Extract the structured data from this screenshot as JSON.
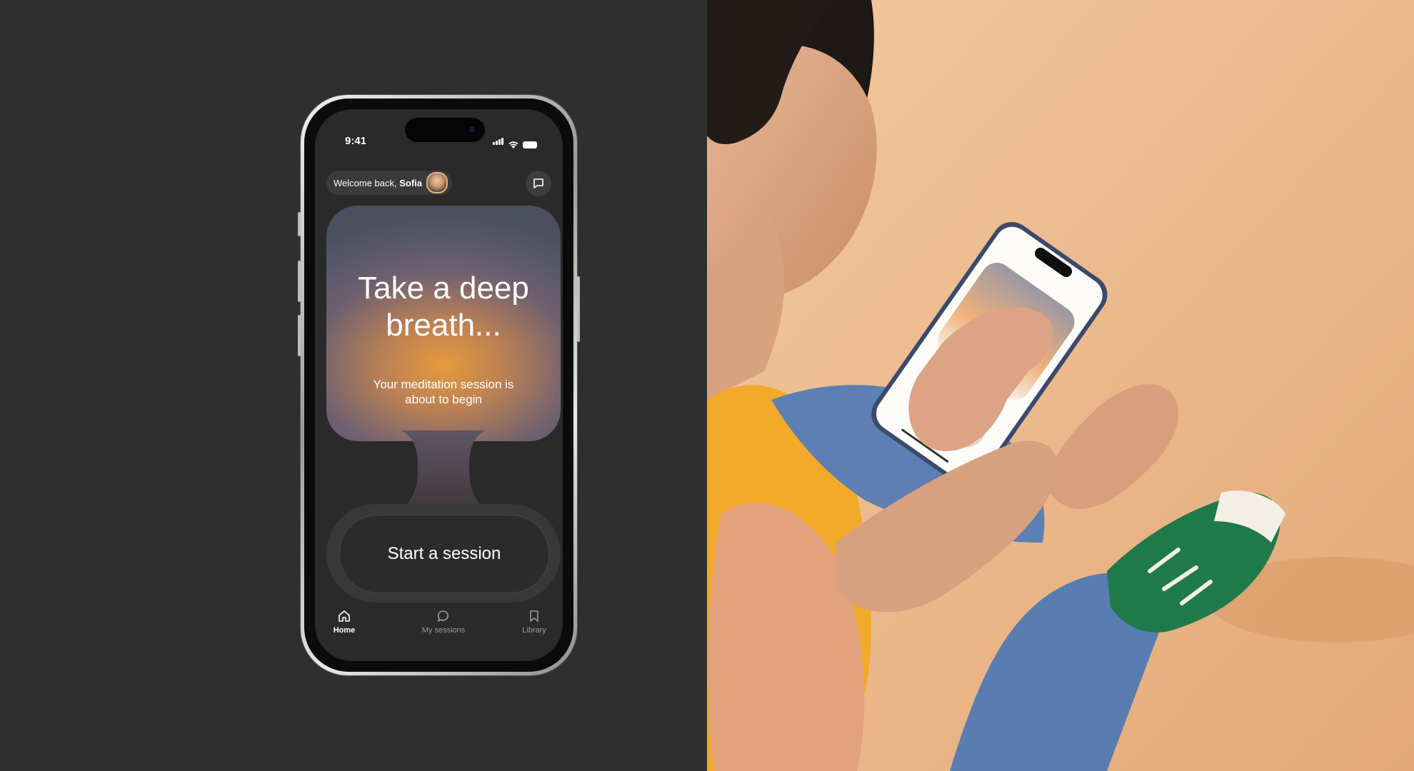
{
  "status_bar": {
    "time": "9:41"
  },
  "header": {
    "welcome_prefix": "Welcome back, ",
    "user_name": "Sofia"
  },
  "hero": {
    "title_line1": "Take a deep",
    "title_line2": "breath...",
    "subtitle_line1": "Your meditation session is",
    "subtitle_line2": "about to begin"
  },
  "session_button": {
    "label": "Start a session"
  },
  "tabs": [
    {
      "label": "Home",
      "icon": "home-icon",
      "active": true
    },
    {
      "label": "My sessions",
      "icon": "chat-bubble-icon",
      "active": false
    },
    {
      "label": "Library",
      "icon": "bookmark-icon",
      "active": false
    }
  ],
  "colors": {
    "background": "#2f2f2f",
    "screen": "#2a2a2a",
    "hero_glow": "#e79a3c",
    "photo_wall": "#f0bf92"
  }
}
